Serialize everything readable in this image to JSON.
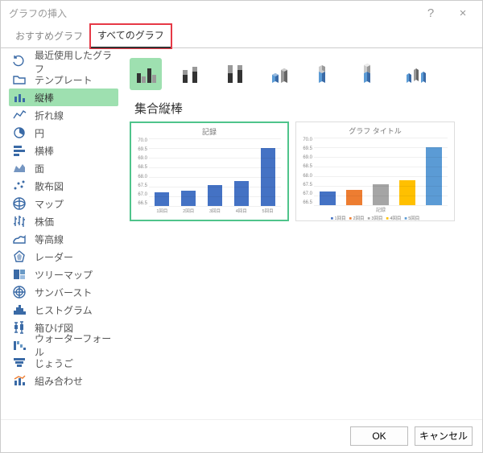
{
  "window": {
    "title": "グラフの挿入"
  },
  "tabs": [
    {
      "label": "おすすめグラフ",
      "active": false
    },
    {
      "label": "すべてのグラフ",
      "active": true,
      "highlighted": true
    }
  ],
  "sidebar": {
    "items": [
      {
        "label": "最近使用したグラフ"
      },
      {
        "label": "テンプレート"
      },
      {
        "label": "縦棒",
        "selected": true
      },
      {
        "label": "折れ線"
      },
      {
        "label": "円"
      },
      {
        "label": "横棒"
      },
      {
        "label": "面"
      },
      {
        "label": "散布図"
      },
      {
        "label": "マップ"
      },
      {
        "label": "株価"
      },
      {
        "label": "等高線"
      },
      {
        "label": "レーダー"
      },
      {
        "label": "ツリーマップ"
      },
      {
        "label": "サンバースト"
      },
      {
        "label": "ヒストグラム"
      },
      {
        "label": "箱ひげ図"
      },
      {
        "label": "ウォーターフォール"
      },
      {
        "label": "じょうご"
      },
      {
        "label": "組み合わせ"
      }
    ]
  },
  "subtitle": "集合縦棒",
  "subtypes_count": 7,
  "preview1": {
    "title": "記録",
    "ytick": [
      "70.0",
      "69.5",
      "69.0",
      "68.5",
      "68.0",
      "67.5",
      "67.0",
      "66.5"
    ]
  },
  "preview2": {
    "title": "グラフ タイトル",
    "ytick": [
      "70.0",
      "69.5",
      "69.0",
      "68.5",
      "68.0",
      "67.5",
      "67.0",
      "66.5"
    ],
    "series_label": "記録"
  },
  "chart_data": {
    "type": "bar",
    "categories": [
      "1回目",
      "2回目",
      "3回目",
      "4回目",
      "5回目"
    ],
    "values": [
      67.2,
      67.3,
      67.6,
      67.8,
      69.5
    ],
    "title": "記録",
    "xlabel": "",
    "ylabel": "",
    "ylim": [
      66.5,
      70.0
    ]
  },
  "buttons": {
    "ok": "OK",
    "cancel": "キャンセル"
  }
}
